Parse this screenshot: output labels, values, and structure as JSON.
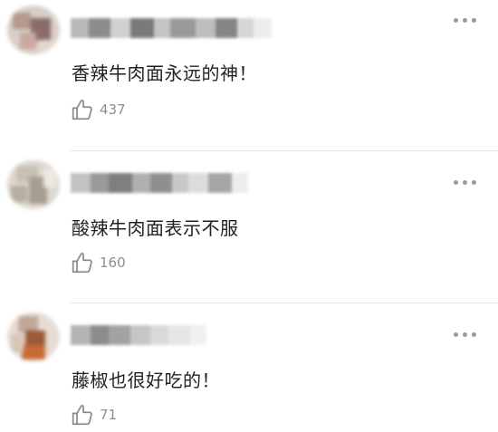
{
  "comments": [
    {
      "text": "香辣牛肉面永远的神！",
      "likes": "437"
    },
    {
      "text": "酸辣牛肉面表示不服",
      "likes": "160"
    },
    {
      "text": "藤椒也很好吃的！",
      "likes": "71"
    }
  ],
  "icons": {
    "like": "thumbs-up-icon",
    "more": "more-dots-icon"
  },
  "colors": {
    "text": "#222222",
    "meta": "#8f8f8f",
    "divider": "#e6e6e6"
  }
}
